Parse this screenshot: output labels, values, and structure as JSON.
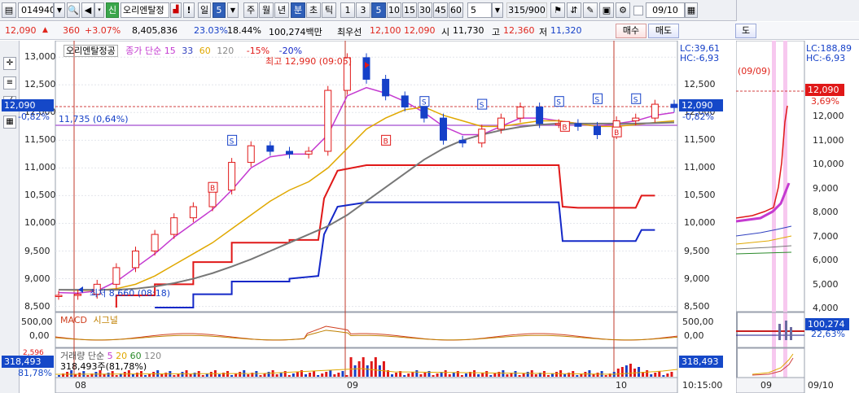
{
  "toolbar": {
    "code": "014940",
    "badge": "신",
    "name": "오리엔탈정",
    "period_day": "일",
    "period_num": "5",
    "tabs": [
      "주",
      "월",
      "년",
      "분",
      "초",
      "틱"
    ],
    "selected_tab": "분",
    "intervals": [
      "1",
      "3",
      "5",
      "10",
      "15",
      "30",
      "45",
      "60"
    ],
    "selected_interval": "5",
    "count_value": "5",
    "page_count": "315/900",
    "date": "09/10",
    "right_tab": "도"
  },
  "infobar": {
    "price": "12,090",
    "change": "360",
    "change_pct": "+3.07%",
    "volume": "8,405,836",
    "turnover_pct": "23.03%",
    "pct2": "18.44%",
    "trade_value": "100,274백만",
    "best_bid_label": "최우선",
    "best_ask": "12,100",
    "best_bid": "12,090",
    "open_label": "시",
    "open": "11,730",
    "high_label": "고",
    "high": "12,360",
    "low_label": "저",
    "low": "11,320",
    "buy_label": "매수",
    "sell_label": "매도"
  },
  "chart_panel": {
    "legend_name": "오리엔탈정공",
    "ma_legend": "종가 단순",
    "ma_periods": [
      "15",
      "33",
      "60",
      "120"
    ],
    "ma_colors": [
      "#c43ad0",
      "#3040c0",
      "#e0a800",
      "#888888"
    ],
    "env_lower": "-15%",
    "env_upper": "-20%",
    "max_label": "최고 12,990 (09:05)",
    "min_label": "최저 8,660 (08:18)",
    "ref_line_label": "11,735 (0,64%)",
    "lc_label": "LC:39,61",
    "hc_label": "HC:-6,93",
    "current_price": "12,090",
    "current_change": "-0,82%",
    "price_ticks": [
      "13,000",
      "12,500",
      "12,000",
      "11,500",
      "11,000",
      "10,500",
      "10,000",
      "9,500",
      "9,000",
      "8,500"
    ],
    "right_ticks": [
      "12,500",
      "12,000",
      "11,500",
      "11,000",
      "10,500",
      "10,000",
      "9,500",
      "9,000",
      "8,500"
    ],
    "x_labels": [
      "08",
      "09",
      "10"
    ],
    "time_label": "10:15:00",
    "signal_letters": [
      "S",
      "B"
    ]
  },
  "macd_panel": {
    "title": "MACD",
    "signal": "시그널",
    "ticks": [
      "500,00",
      "0,00"
    ]
  },
  "volume_panel": {
    "title": "거래량 단순",
    "periods": [
      "5",
      "20",
      "60",
      "120"
    ],
    "value_label": "318,493주(81,78%)",
    "left_value": "318,493",
    "left_pct": "81,78%",
    "left_pct_top": "2,596",
    "right_value": "318,493"
  },
  "side_chart": {
    "lc_label": "LC:188,89",
    "hc_label": "HC:-6,93",
    "date_label": "(09/09)",
    "price": "12,090",
    "pct": "3,69%",
    "ticks": [
      "12,000",
      "11,000",
      "10,000",
      "9,000",
      "8,000",
      "7,000",
      "6,000",
      "5,000",
      "4,000"
    ],
    "macd_value": "100,274",
    "macd_pct": "22,63%",
    "x_label": "09",
    "date_bottom": "09/10"
  },
  "chart_data": {
    "type": "line",
    "title": "",
    "x": [
      "08",
      "09",
      "10"
    ],
    "series": [
      {
        "name": "종가",
        "values": [
          8700,
          8720,
          8900,
          9200,
          9500,
          9800,
          10100,
          10300,
          10600,
          11100,
          11400,
          11300,
          11250,
          11300,
          12400,
          12990,
          12600,
          12300,
          12100,
          11900,
          11500,
          11450,
          11700,
          11900,
          12100,
          11800,
          11800,
          11750,
          11600,
          11850,
          11900,
          12150,
          12090
        ]
      },
      {
        "name": "15",
        "values": [
          8750,
          8740,
          8780,
          8950,
          9200,
          9450,
          9750,
          10000,
          10250,
          10600,
          11000,
          11200,
          11250,
          11250,
          11600,
          12300,
          12450,
          12350,
          12200,
          12000,
          11750,
          11600,
          11600,
          11750,
          11900,
          11900,
          11850,
          11800,
          11750,
          11800,
          11850,
          11950,
          12000
        ]
      },
      {
        "name": "60",
        "values": [
          8800,
          8790,
          8790,
          8820,
          8900,
          9050,
          9250,
          9450,
          9650,
          9900,
          10150,
          10400,
          10600,
          10750,
          11000,
          11350,
          11700,
          11900,
          12050,
          12100,
          11950,
          11850,
          11750,
          11750,
          11800,
          11850,
          11850,
          11800,
          11750,
          11750,
          11780,
          11820,
          11850
        ]
      },
      {
        "name": "120",
        "values": [
          8800,
          8800,
          8800,
          8800,
          8820,
          8860,
          8920,
          9000,
          9100,
          9220,
          9350,
          9500,
          9650,
          9800,
          9950,
          10150,
          10400,
          10650,
          10900,
          11150,
          11350,
          11500,
          11600,
          11680,
          11740,
          11780,
          11800,
          11800,
          11800,
          11800,
          11800,
          11810,
          11820
        ]
      }
    ],
    "ylim": [
      8450,
      13150
    ]
  }
}
